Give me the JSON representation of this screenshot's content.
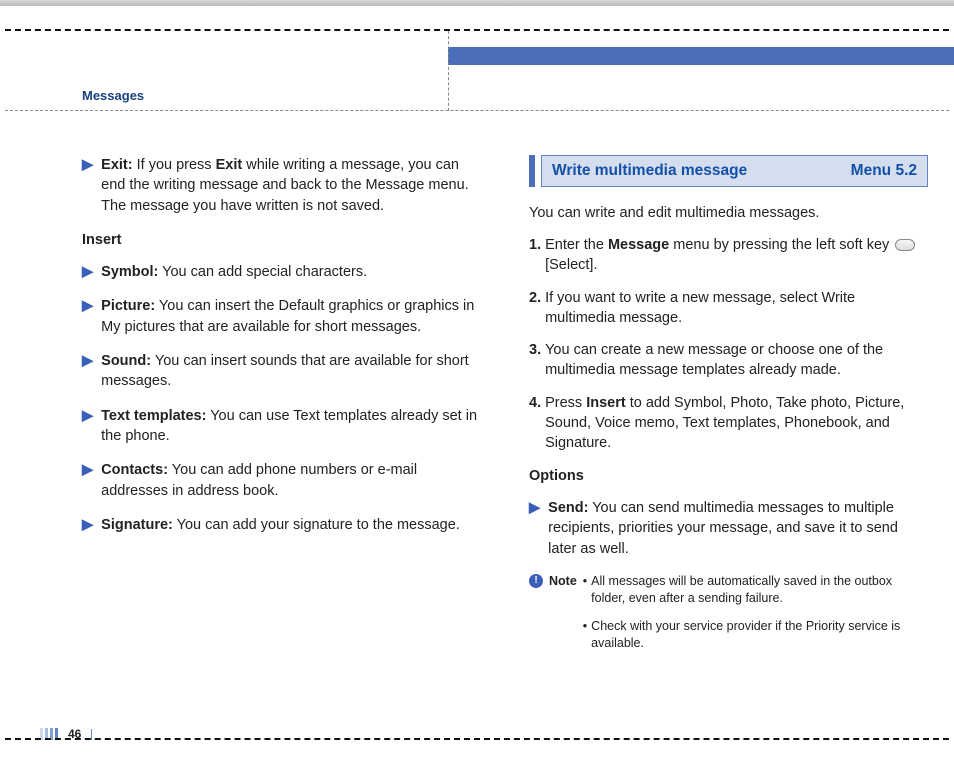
{
  "header": {
    "section": "Messages"
  },
  "left": {
    "exit": {
      "label": "Exit:",
      "key": "Exit",
      "text_before": " If you press ",
      "text_after": " while writing a message, you can end the writing message and back to the Message menu. The message you have written is not saved."
    },
    "insert_heading": "Insert",
    "items": [
      {
        "label": "Symbol:",
        "text": " You can add special characters."
      },
      {
        "label": "Picture:",
        "text": " You can insert the Default graphics or graphics in My pictures that are available for short messages."
      },
      {
        "label": "Sound:",
        "text": " You can insert sounds that are available for short messages."
      },
      {
        "label": "Text templates:",
        "text": " You can use Text templates already set in the phone."
      },
      {
        "label": "Contacts:",
        "text": " You can add phone numbers or e-mail addresses in address book."
      },
      {
        "label": "Signature:",
        "text": " You can add your signature to the message."
      }
    ]
  },
  "right": {
    "title": "Write multimedia message",
    "menu": "Menu 5.2",
    "intro": "You can write and edit multimedia messages.",
    "steps": {
      "s1_a": "Enter the ",
      "s1_b": "Message",
      "s1_c": " menu by pressing the left soft key ",
      "s1_d": " [Select].",
      "s2": "If you want to write a new message, select Write multimedia message.",
      "s3": "You can create a new message or choose one of the multimedia message templates already made.",
      "s4_a": "Press ",
      "s4_b": "Insert",
      "s4_c": " to add Symbol, Photo, Take photo, Picture, Sound, Voice memo, Text templates, Phonebook, and Signature."
    },
    "options_heading": "Options",
    "send": {
      "label": "Send:",
      "text": " You can send multimedia messages to multiple recipients, priorities your message, and save it to send later as well."
    },
    "note_label": "Note",
    "notes": [
      "All messages will be automatically saved in the outbox folder,  even after a sending failure.",
      "Check with your service provider if the Priority service is available."
    ]
  },
  "footer": {
    "page": "46"
  }
}
